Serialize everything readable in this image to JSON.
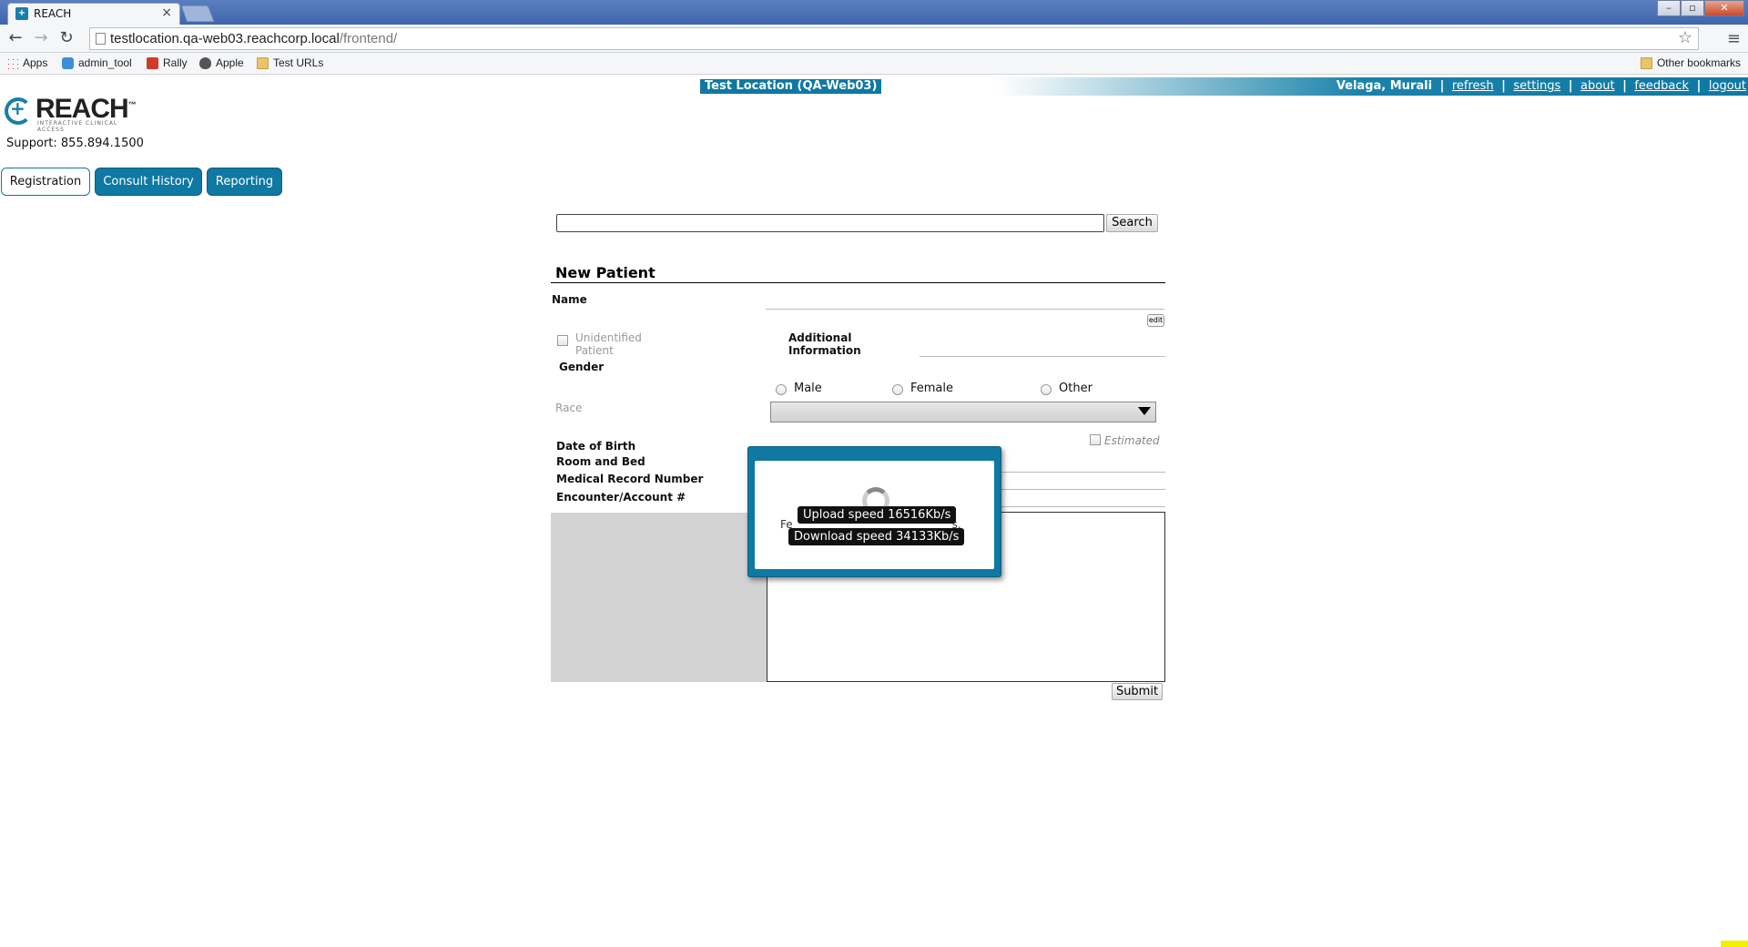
{
  "browser": {
    "tab_title": "REACH",
    "tab_favicon": "reach-favicon",
    "url_host": "testlocation.qa-web03.reachcorp.local",
    "url_path": "/frontend/",
    "bookmarks": [
      {
        "label": "Apps",
        "icon": "apps-grid-icon"
      },
      {
        "label": "admin_tool",
        "icon": "puzzle-icon"
      },
      {
        "label": "Rally",
        "icon": "rally-icon"
      },
      {
        "label": "Apple",
        "icon": "apple-icon"
      },
      {
        "label": "Test URLs",
        "icon": "folder-icon"
      }
    ],
    "other_bookmarks": "Other bookmarks"
  },
  "header": {
    "location": "Test Location (QA-Web03)",
    "user": "Velaga, Murali",
    "links": {
      "refresh": "refresh",
      "settings": "settings",
      "about": "about",
      "feedback": "feedback",
      "logout": "logout"
    },
    "separator": "|"
  },
  "brand": {
    "name": "REACH",
    "tm": "™",
    "tagline": "INTERACTIVE CLINICAL ACCESS",
    "support": "Support: 855.894.1500"
  },
  "nav": {
    "registration": "Registration",
    "consult_history": "Consult History",
    "reporting": "Reporting"
  },
  "search": {
    "value": "",
    "button": "Search"
  },
  "form": {
    "title": "New Patient",
    "name_label": "Name",
    "edit_label": "edit",
    "unidentified_line1": "Unidentified",
    "unidentified_line2": "Patient",
    "additional_line1": "Additional",
    "additional_line2": "Information",
    "gender_label": "Gender",
    "gender_options": [
      "Male",
      "Female",
      "Other"
    ],
    "race_label": "Race",
    "estimated_label": "Estimated",
    "dob_label": "Date of Birth",
    "room_label": "Room and Bed",
    "mrn_label": "Medical Record Number",
    "encounter_label": "Encounter/Account #",
    "submit": "Submit"
  },
  "modal": {
    "partial_text_left": "Fe",
    "partial_text_right": "s.",
    "upload": "Upload speed 16516Kb/s",
    "download": "Download speed 34133Kb/s"
  }
}
